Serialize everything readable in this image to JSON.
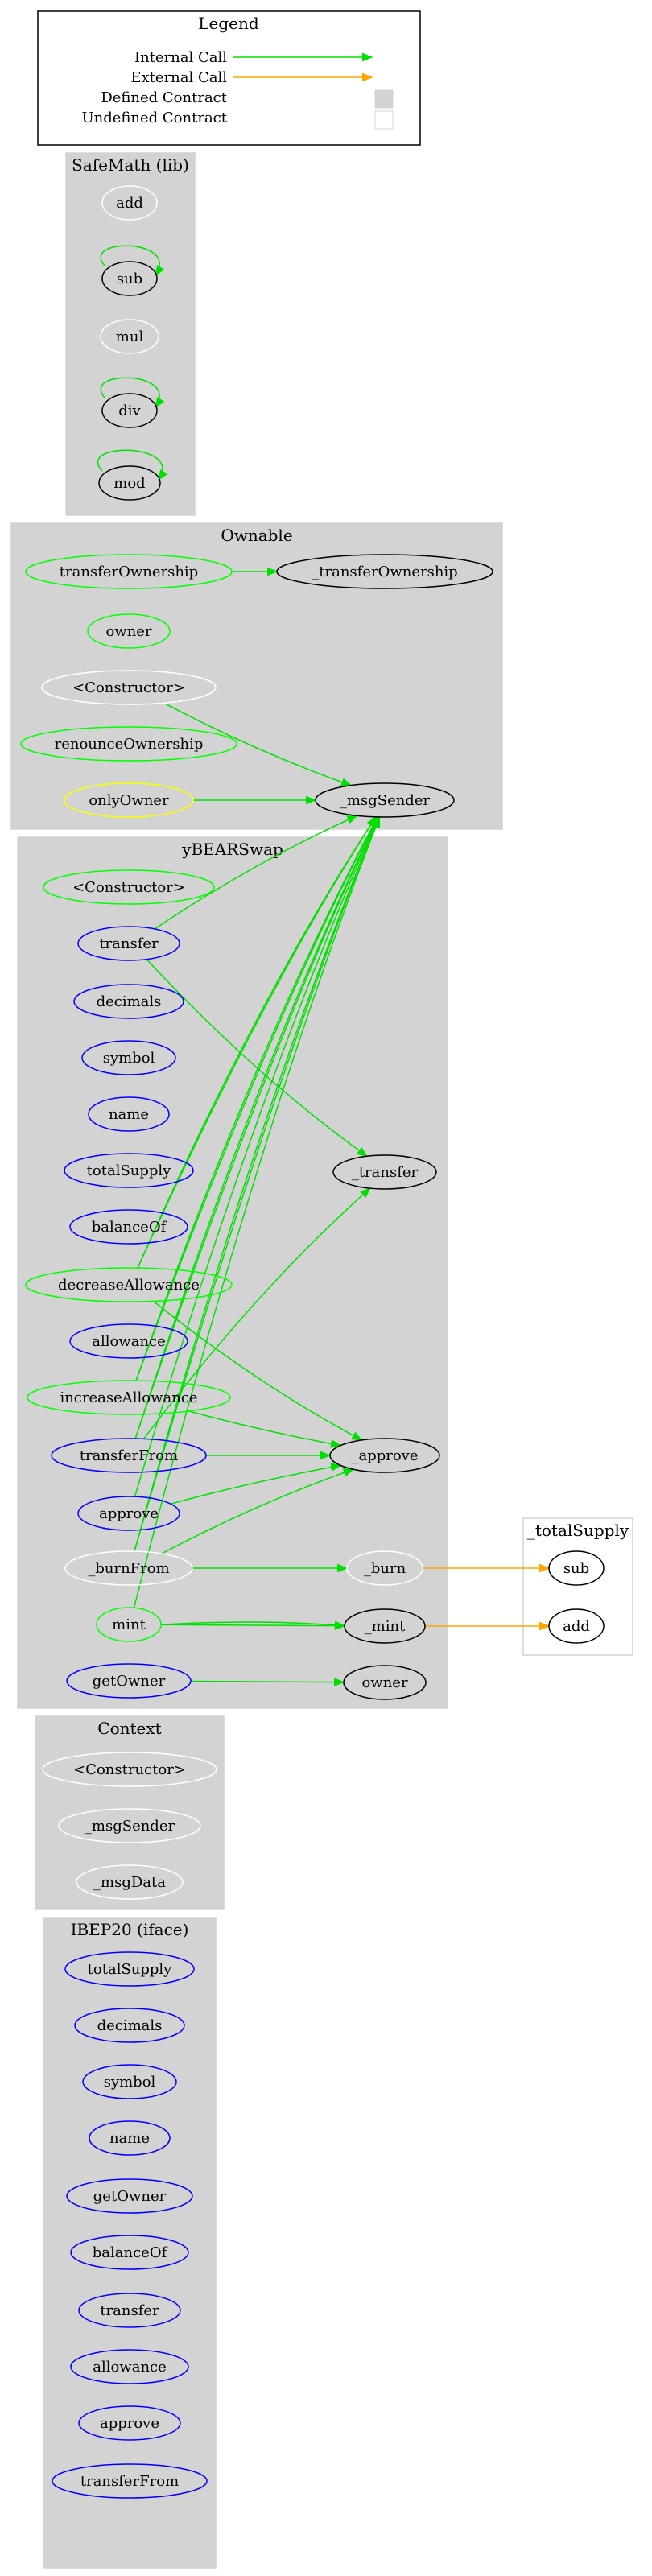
{
  "colors": {
    "internal": "#00e000",
    "external": "#ffa500",
    "public_node": "#00ff00",
    "external_node": "#0000ff",
    "modifier_node": "#ffff00",
    "internal_node": "#ffffff",
    "defined_fill": "#d3d3d3",
    "undefined_border": "#d3d3d3"
  },
  "legend": {
    "title": "Legend",
    "items": [
      {
        "label": "Internal Call",
        "kind": "internal"
      },
      {
        "label": "External Call",
        "kind": "external"
      },
      {
        "label": "Defined Contract",
        "kind": "defined"
      },
      {
        "label": "Undefined Contract",
        "kind": "undefined"
      }
    ]
  },
  "clusters": [
    {
      "id": "safemath",
      "title": "SafeMath  (lib)",
      "nodes": [
        {
          "id": "sm_add",
          "label": "add",
          "style": "internal"
        },
        {
          "id": "sm_sub",
          "label": "sub",
          "style": "black"
        },
        {
          "id": "sm_mul",
          "label": "mul",
          "style": "internal"
        },
        {
          "id": "sm_div",
          "label": "div",
          "style": "black"
        },
        {
          "id": "sm_mod",
          "label": "mod",
          "style": "black"
        }
      ]
    },
    {
      "id": "ownable",
      "title": "Ownable",
      "nodes": [
        {
          "id": "ow_transferOwnership",
          "label": "transferOwnership",
          "style": "public"
        },
        {
          "id": "ow__transferOwnership",
          "label": "_transferOwnership",
          "style": "black"
        },
        {
          "id": "ow_owner",
          "label": "owner",
          "style": "public"
        },
        {
          "id": "ow_constructor",
          "label": "<Constructor>",
          "style": "internal"
        },
        {
          "id": "ow_renounceOwnership",
          "label": "renounceOwnership",
          "style": "public"
        },
        {
          "id": "ow_onlyOwner",
          "label": "onlyOwner",
          "style": "modifier"
        },
        {
          "id": "ow__msgSender",
          "label": "_msgSender",
          "style": "black"
        }
      ]
    },
    {
      "id": "ybearswap",
      "title": "yBEARSwap",
      "nodes": [
        {
          "id": "yb_constructor",
          "label": "<Constructor>",
          "style": "public"
        },
        {
          "id": "yb_transfer",
          "label": "transfer",
          "style": "external"
        },
        {
          "id": "yb_decimals",
          "label": "decimals",
          "style": "external"
        },
        {
          "id": "yb_symbol",
          "label": "symbol",
          "style": "external"
        },
        {
          "id": "yb_name",
          "label": "name",
          "style": "external"
        },
        {
          "id": "yb_totalSupply",
          "label": "totalSupply",
          "style": "external"
        },
        {
          "id": "yb_balanceOf",
          "label": "balanceOf",
          "style": "external"
        },
        {
          "id": "yb_decreaseAllowance",
          "label": "decreaseAllowance",
          "style": "public"
        },
        {
          "id": "yb_allowance",
          "label": "allowance",
          "style": "external"
        },
        {
          "id": "yb_increaseAllowance",
          "label": "increaseAllowance",
          "style": "public"
        },
        {
          "id": "yb_transferFrom",
          "label": "transferFrom",
          "style": "external"
        },
        {
          "id": "yb_approve",
          "label": "approve",
          "style": "external"
        },
        {
          "id": "yb__burnFrom",
          "label": "_burnFrom",
          "style": "internal"
        },
        {
          "id": "yb_mint",
          "label": "mint",
          "style": "public"
        },
        {
          "id": "yb_getOwner",
          "label": "getOwner",
          "style": "external"
        },
        {
          "id": "yb__transfer",
          "label": "_transfer",
          "style": "black"
        },
        {
          "id": "yb__approve",
          "label": "_approve",
          "style": "black"
        },
        {
          "id": "yb__burn",
          "label": "_burn",
          "style": "internal"
        },
        {
          "id": "yb__mint",
          "label": "_mint",
          "style": "black"
        },
        {
          "id": "yb_owner",
          "label": "owner",
          "style": "black"
        }
      ]
    },
    {
      "id": "ts",
      "title": "_totalSupply",
      "nodes": [
        {
          "id": "ts_sub",
          "label": "sub",
          "style": "black"
        },
        {
          "id": "ts_add",
          "label": "add",
          "style": "black"
        }
      ]
    },
    {
      "id": "context",
      "title": "Context",
      "nodes": [
        {
          "id": "cx_constructor",
          "label": "<Constructor>",
          "style": "internal"
        },
        {
          "id": "cx__msgSender",
          "label": "_msgSender",
          "style": "internal"
        },
        {
          "id": "cx__msgData",
          "label": "_msgData",
          "style": "internal"
        }
      ]
    },
    {
      "id": "ibep20",
      "title": "IBEP20  (iface)",
      "nodes": [
        {
          "id": "ib_totalSupply",
          "label": "totalSupply",
          "style": "external"
        },
        {
          "id": "ib_decimals",
          "label": "decimals",
          "style": "external"
        },
        {
          "id": "ib_symbol",
          "label": "symbol",
          "style": "external"
        },
        {
          "id": "ib_name",
          "label": "name",
          "style": "external"
        },
        {
          "id": "ib_getOwner",
          "label": "getOwner",
          "style": "external"
        },
        {
          "id": "ib_balanceOf",
          "label": "balanceOf",
          "style": "external"
        },
        {
          "id": "ib_transfer",
          "label": "transfer",
          "style": "external"
        },
        {
          "id": "ib_allowance",
          "label": "allowance",
          "style": "external"
        },
        {
          "id": "ib_approve",
          "label": "approve",
          "style": "external"
        },
        {
          "id": "ib_transferFrom",
          "label": "transferFrom",
          "style": "external"
        }
      ]
    }
  ],
  "edges": [
    {
      "from": "sm_sub",
      "to": "sm_sub",
      "kind": "internal"
    },
    {
      "from": "sm_div",
      "to": "sm_div",
      "kind": "internal"
    },
    {
      "from": "sm_mod",
      "to": "sm_mod",
      "kind": "internal"
    },
    {
      "from": "ow_transferOwnership",
      "to": "ow__transferOwnership",
      "kind": "internal"
    },
    {
      "from": "ow_constructor",
      "to": "ow__msgSender",
      "kind": "internal"
    },
    {
      "from": "ow_onlyOwner",
      "to": "ow__msgSender",
      "kind": "internal"
    },
    {
      "from": "yb_transfer",
      "to": "ow__msgSender",
      "kind": "internal"
    },
    {
      "from": "yb_transfer",
      "to": "yb__transfer",
      "kind": "internal"
    },
    {
      "from": "yb_decreaseAllowance",
      "to": "ow__msgSender",
      "kind": "internal"
    },
    {
      "from": "yb_decreaseAllowance",
      "to": "ow__msgSender",
      "kind": "internal"
    },
    {
      "from": "yb_decreaseAllowance",
      "to": "yb__approve",
      "kind": "internal"
    },
    {
      "from": "yb_increaseAllowance",
      "to": "ow__msgSender",
      "kind": "internal"
    },
    {
      "from": "yb_increaseAllowance",
      "to": "ow__msgSender",
      "kind": "internal"
    },
    {
      "from": "yb_increaseAllowance",
      "to": "yb__approve",
      "kind": "internal"
    },
    {
      "from": "yb_transferFrom",
      "to": "yb__transfer",
      "kind": "internal"
    },
    {
      "from": "yb_transferFrom",
      "to": "ow__msgSender",
      "kind": "internal"
    },
    {
      "from": "yb_transferFrom",
      "to": "ow__msgSender",
      "kind": "internal"
    },
    {
      "from": "yb_transferFrom",
      "to": "yb__approve",
      "kind": "internal"
    },
    {
      "from": "yb_approve",
      "to": "ow__msgSender",
      "kind": "internal"
    },
    {
      "from": "yb_approve",
      "to": "yb__approve",
      "kind": "internal"
    },
    {
      "from": "yb__burnFrom",
      "to": "yb__burn",
      "kind": "internal"
    },
    {
      "from": "yb__burnFrom",
      "to": "yb__approve",
      "kind": "internal"
    },
    {
      "from": "yb__burnFrom",
      "to": "ow__msgSender",
      "kind": "internal"
    },
    {
      "from": "yb__burnFrom",
      "to": "ow__msgSender",
      "kind": "internal"
    },
    {
      "from": "yb_mint",
      "to": "yb__mint",
      "kind": "internal"
    },
    {
      "from": "yb_mint",
      "to": "yb__mint",
      "kind": "internal"
    },
    {
      "from": "yb_mint",
      "to": "ow__msgSender",
      "kind": "internal"
    },
    {
      "from": "yb_getOwner",
      "to": "yb_owner",
      "kind": "internal"
    },
    {
      "from": "yb__burn",
      "to": "ts_sub",
      "kind": "external"
    },
    {
      "from": "yb__mint",
      "to": "ts_add",
      "kind": "external"
    }
  ]
}
